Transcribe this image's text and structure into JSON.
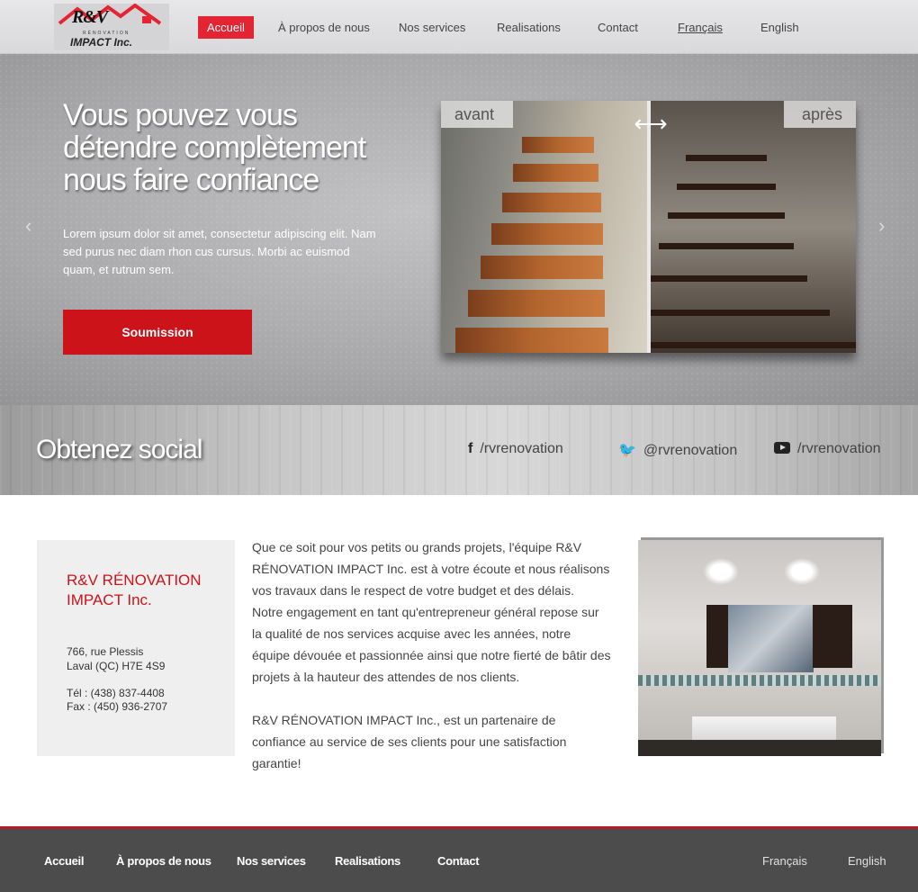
{
  "header": {
    "logo": {
      "brand": "R&V",
      "tagline": "RÉNOVATION",
      "name": "IMPACT Inc."
    },
    "nav": [
      {
        "label": "Accueil",
        "active": true
      },
      {
        "label": "À propos de nous"
      },
      {
        "label": "Nos services"
      },
      {
        "label": "Realisations"
      },
      {
        "label": "Contact"
      },
      {
        "label": "Français",
        "underline": true
      },
      {
        "label": "English"
      }
    ]
  },
  "hero": {
    "title": "Vous pouvez vous détendre complètement nous faire confiance",
    "text": "Lorem ipsum dolor sit amet, consectetur adipiscing elit. Nam sed purus nec diam rhon cus cursus. Morbi ac euismod quam, et rutrum sem.",
    "button": "Soumission",
    "before_label": "avant",
    "after_label": "après",
    "prev_arrow": "‹",
    "next_arrow": "›"
  },
  "social": {
    "title": "Obtenez social",
    "facebook": "/rvrenovation",
    "twitter": "@rvrenovation",
    "youtube": "/rvrenovation"
  },
  "contact": {
    "company": "R&V RÉNOVATION IMPACT Inc.",
    "street": "766, rue Plessis",
    "city": "Laval (QC) H7E 4S9",
    "phone": "Tél : (438) 837-4408",
    "fax": "Fax : (450) 936-2707"
  },
  "about": {
    "p1": "Que ce soit pour vos petits ou grands projets, l'équipe R&V RÉNOVATION IMPACT Inc. est à votre écoute et nous réalisons vos travaux dans le respect de votre budget et des délais.",
    "p2": "Notre engagement en tant qu'entrepreneur général repose sur la qualité de nos services acquise avec les années, notre équipe dévouée et passionnée ainsi que notre fierté de bâtir des projets à la hauteur des attendes de nos clients.",
    "p3": "R&V RÉNOVATION IMPACT Inc., est un partenaire de confiance au service de ses clients pour une satisfaction garantie!"
  },
  "footer": {
    "nav": [
      "Accueil",
      "À propos de nous",
      "Nos services",
      "Realisations",
      "Contact"
    ],
    "lang": [
      "Français",
      "English"
    ]
  },
  "colors": {
    "accent": "#e52433",
    "button": "#cc1319",
    "footer": "#4c4c4c"
  }
}
